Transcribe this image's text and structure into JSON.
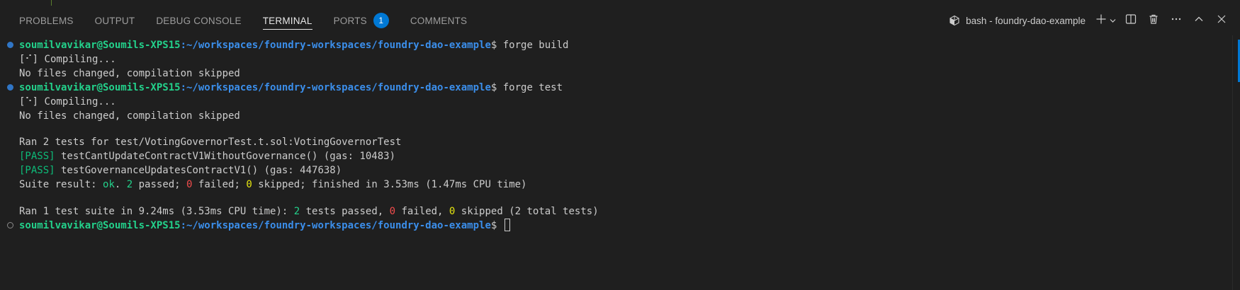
{
  "tabs": [
    {
      "label": "PROBLEMS"
    },
    {
      "label": "OUTPUT"
    },
    {
      "label": "DEBUG CONSOLE"
    },
    {
      "label": "TERMINAL",
      "active": true
    },
    {
      "label": "PORTS",
      "badge": "1"
    },
    {
      "label": "COMMENTS"
    }
  ],
  "terminal_name": "bash - foundry-dao-example",
  "icons": [
    "terminal-bash-icon",
    "plus-icon",
    "chevron-down-icon",
    "split-icon",
    "trash-icon",
    "more-icon",
    "maximize-icon",
    "close-icon"
  ],
  "colors": {
    "accent": "#0078d4",
    "user": "#23d18b",
    "path": "#3b8eea",
    "red": "#f14c4c",
    "yellow": "#e5e510"
  },
  "prompt": {
    "user": "soumilvavikar@Soumils-XPS15",
    "path": ":~/workspaces/foundry-workspaces/foundry-dao-example",
    "symbol": "$ "
  },
  "lines": {
    "cmd1": "forge build",
    "compile1_icon": "[⠊]",
    "compile1_text": " Compiling...",
    "nochange1": "No files changed, compilation skipped",
    "cmd2": "forge test",
    "compile2_icon": "[⠑]",
    "compile2_text": " Compiling...",
    "nochange2": "No files changed, compilation skipped",
    "ran_tests": "Ran 2 tests for test/VotingGovernorTest.t.sol:VotingGovernorTest",
    "pass_tag": "[PASS]",
    "test1": " testCantUpdateContractV1WithoutGovernance() (gas: 10483)",
    "test2": " testGovernanceUpdatesContractV1() (gas: 447638)",
    "suite_prefix": "Suite result: ",
    "suite_ok": "ok",
    "suite_dot": ". ",
    "suite_passed_n": "2",
    "suite_passed_txt": " passed; ",
    "suite_failed_n": "0",
    "suite_failed_txt": " failed; ",
    "suite_skipped_n": "0",
    "suite_skipped_txt": " skipped; finished in 3.53ms (1.47ms CPU time)",
    "ran_suite_prefix": "Ran 1 test suite in 9.24ms (3.53ms CPU time): ",
    "ran_passed_n": "2",
    "ran_passed_txt": " tests passed, ",
    "ran_failed_n": "0",
    "ran_failed_txt": " failed, ",
    "ran_skipped_n": "0",
    "ran_skipped_txt": " skipped (2 total tests)"
  }
}
